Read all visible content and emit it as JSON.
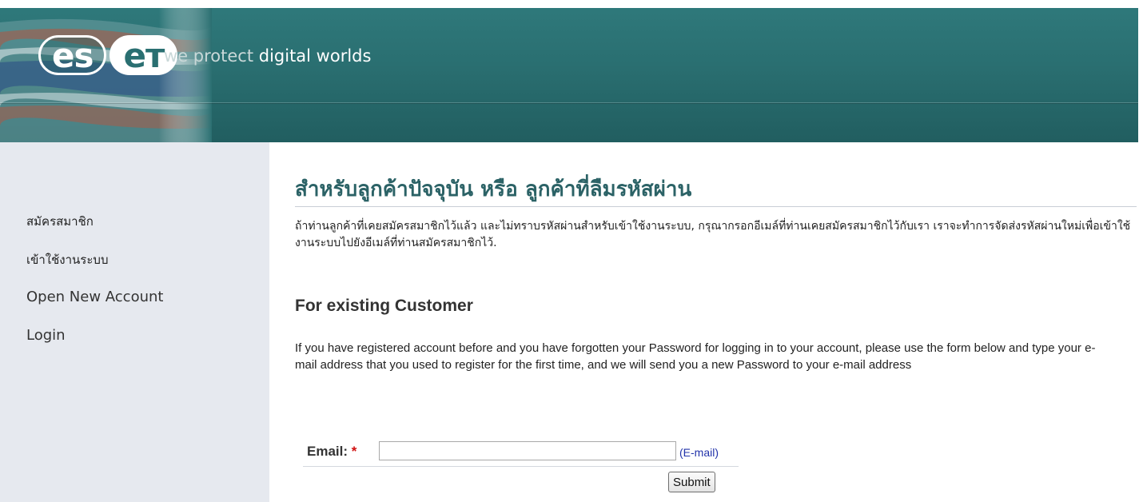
{
  "header": {
    "logo_part1": "es",
    "logo_part2": "eт",
    "tagline_muted": "we protect",
    "tagline_rest": " digital worlds",
    "brand_color": "#2a6f71"
  },
  "sidebar": {
    "items": [
      {
        "label": "สมัครสมาชิก"
      },
      {
        "label": "เข้าใช้งานระบบ"
      },
      {
        "label": "Open New Account"
      },
      {
        "label": "Login"
      }
    ]
  },
  "content": {
    "heading_th": "สำหรับลูกค้าปัจจุบัน หรือ ลูกค้าที่ลืมรหัสผ่าน",
    "paragraph_th": "ถ้าท่านลูกค้าที่เคยสมัครสมาชิกไว้แล้ว และไม่ทราบรหัสผ่านสำหรับเข้าใช้งานระบบ, กรุณากรอกอีเมล์ที่ท่านเคยสมัครสมาชิกไว้กับเรา เราจะทำการจัดส่งรหัสผ่านใหม่เพื่อเข้าใช้งานระบบไปยังอีเมล์ที่ท่านสมัครสมาชิกไว้.",
    "heading_en": "For existing Customer",
    "paragraph_en": "If you have registered account before and you have forgotten your Password for logging in to your account, please use the form below and type your e-mail address that you used to register for the first time, and we will send you a new Password to your e-mail address"
  },
  "form": {
    "email_label": "Email:",
    "required_mark": "*",
    "email_value": "",
    "email_hint": "(E-mail)",
    "submit_label": "Submit"
  }
}
